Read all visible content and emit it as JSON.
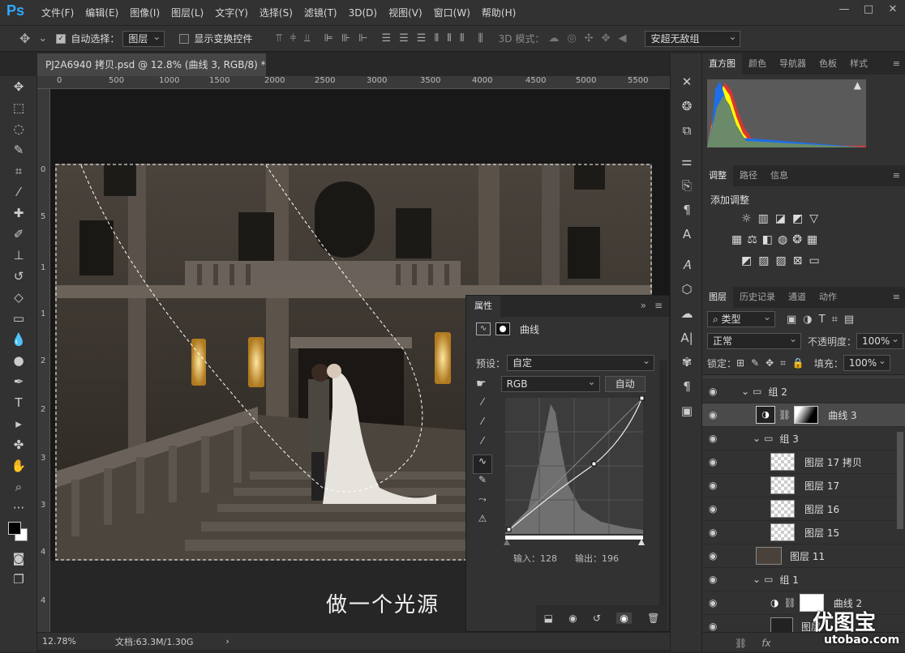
{
  "app": {
    "logo": "Ps",
    "menus": [
      "文件(F)",
      "编辑(E)",
      "图像(I)",
      "图层(L)",
      "文字(Y)",
      "选择(S)",
      "滤镜(T)",
      "3D(D)",
      "视图(V)",
      "窗口(W)",
      "帮助(H)"
    ],
    "window_controls": [
      "—",
      "□",
      "✕"
    ]
  },
  "options": {
    "auto_select_label": "自动选择：",
    "auto_select_target": "图层",
    "show_transform_label": "显示变换控件",
    "mode_3d_label": "3D 模式：",
    "workspace": "安超无敌组"
  },
  "document": {
    "tab_title": "PJ2A6940 拷贝.psd @ 12.8% (曲线 3, RGB/8) *",
    "close": "×",
    "caption": "做一个光源",
    "zoom": "12.78%",
    "doc_info": "文档:63.3M/1.30G",
    "status_arrow": "›"
  },
  "ruler": {
    "h_ticks": [
      "0",
      "500",
      "1000",
      "1500",
      "2000",
      "2500",
      "3000",
      "3500",
      "4000",
      "4500",
      "5000",
      "5500"
    ],
    "v_ticks": [
      "0",
      "5",
      "1",
      "1",
      "2",
      "2",
      "3",
      "3",
      "4",
      "4"
    ]
  },
  "histogram_panel": {
    "tabs": [
      "直方图",
      "颜色",
      "导航器",
      "色板",
      "样式"
    ],
    "warning": "▲"
  },
  "adjust_panel": {
    "tabs": [
      "调整",
      "路径",
      "信息"
    ],
    "title": "添加调整"
  },
  "layers_panel": {
    "tabs": [
      "图层",
      "历史记录",
      "通道",
      "动作"
    ],
    "filter_kind": "类型",
    "blend_mode": "正常",
    "opacity_label": "不透明度：",
    "opacity": "100%",
    "lock_label": "锁定：",
    "fill_label": "填充：",
    "fill": "100%",
    "layers": [
      {
        "name": "组 2",
        "type": "group",
        "indent": 1
      },
      {
        "name": "曲线 3",
        "type": "adjust",
        "indent": 2
      },
      {
        "name": "组 3",
        "type": "group",
        "indent": 2
      },
      {
        "name": "图层 17 拷贝",
        "type": "pixel",
        "indent": 3
      },
      {
        "name": "图层 17",
        "type": "pixel",
        "indent": 3
      },
      {
        "name": "图层 16",
        "type": "pixel",
        "indent": 3
      },
      {
        "name": "图层 15",
        "type": "pixel",
        "indent": 3
      },
      {
        "name": "图层 11",
        "type": "photo",
        "indent": 2
      },
      {
        "name": "组 1",
        "type": "group",
        "indent": 2
      },
      {
        "name": "曲线 2",
        "type": "adjust",
        "indent": 3
      },
      {
        "name": "图层",
        "type": "photo",
        "indent": 3
      }
    ],
    "bottom_icons": [
      "⛓",
      "fx"
    ]
  },
  "properties": {
    "title": "属性",
    "panel_name": "曲线",
    "preset_label": "预设：",
    "preset": "自定",
    "channel": "RGB",
    "auto_button": "自动",
    "input_label": "输入：128",
    "output_label": "输出：196"
  },
  "watermark": {
    "brand": "优图宝",
    "url": "utobao.com"
  }
}
